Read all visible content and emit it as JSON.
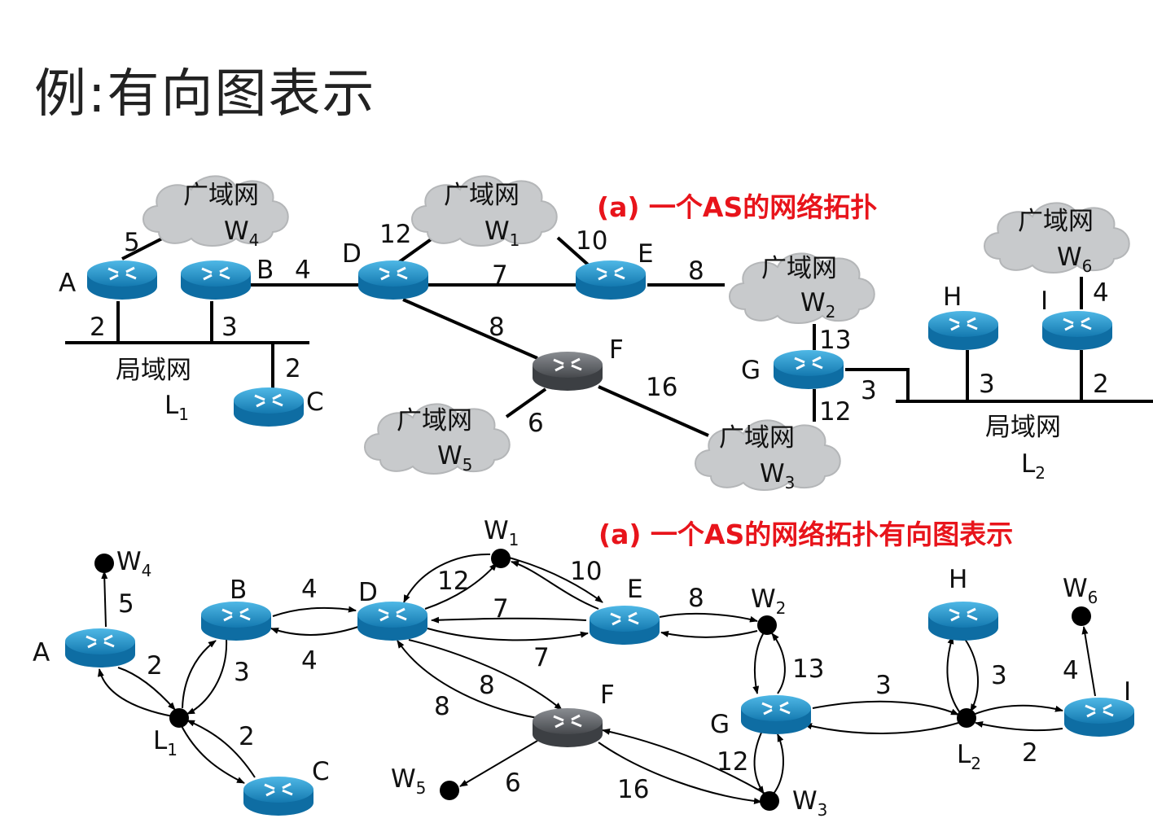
{
  "title": "例:有向图表示",
  "caption_top": "(a)  一个AS的网络拓扑",
  "caption_bottom": "(a)  一个AS的网络拓扑有向图表示",
  "wan": "广域网",
  "lan": "局域网",
  "top": {
    "routers": [
      "A",
      "B",
      "C",
      "D",
      "E",
      "F",
      "G",
      "H",
      "I"
    ],
    "clouds": [
      {
        "name": "W",
        "sub": "4"
      },
      {
        "name": "W",
        "sub": "1"
      },
      {
        "name": "W",
        "sub": "2"
      },
      {
        "name": "W",
        "sub": "5"
      },
      {
        "name": "W",
        "sub": "3"
      },
      {
        "name": "W",
        "sub": "6"
      }
    ],
    "lans": [
      {
        "name": "L",
        "sub": "1"
      },
      {
        "name": "L",
        "sub": "2"
      }
    ],
    "costs": [
      "5",
      "2",
      "3",
      "2",
      "4",
      "12",
      "7",
      "10",
      "8",
      "8",
      "16",
      "6",
      "13",
      "12",
      "3",
      "3",
      "2",
      "4"
    ]
  },
  "bottom": {
    "routers": [
      "A",
      "B",
      "C",
      "D",
      "E",
      "F",
      "G",
      "H",
      "I"
    ],
    "points": [
      {
        "name": "W",
        "sub": "4"
      },
      {
        "name": "W",
        "sub": "1"
      },
      {
        "name": "W",
        "sub": "2"
      },
      {
        "name": "W",
        "sub": "6"
      },
      {
        "name": "W",
        "sub": "5"
      },
      {
        "name": "W",
        "sub": "3"
      },
      {
        "name": "L",
        "sub": "1"
      },
      {
        "name": "L",
        "sub": "2"
      }
    ],
    "costs": [
      "5",
      "2",
      "3",
      "2",
      "4",
      "4",
      "12",
      "10",
      "7",
      "7",
      "8",
      "8",
      "8",
      "13",
      "3",
      "3",
      "4",
      "2",
      "12",
      "6",
      "16"
    ]
  },
  "colors": {
    "caption": "#e8141b",
    "router": "#1a8fc8",
    "router_f": "#5b5e63",
    "cloud": "#c8cacc"
  }
}
